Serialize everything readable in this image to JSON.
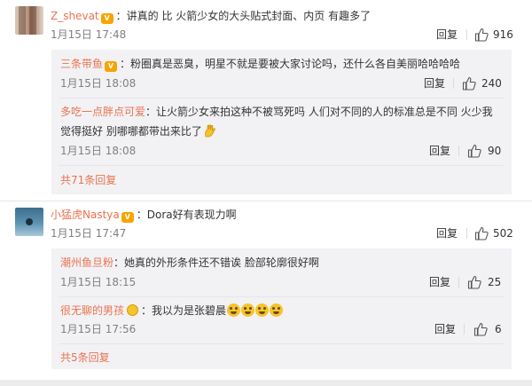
{
  "comments": [
    {
      "user": "Z_shevat",
      "vip_badge": "V",
      "text": "：讲真的 比 火箭少女的大头贴式封面、内页 有趣多了",
      "time": "1月15日 17:48",
      "reply_label": "回复",
      "likes": "916",
      "replies": [
        {
          "user": "三条带鱼",
          "vip_badge": "V",
          "text": "：粉圈真是恶臭，明星不就是要被大家讨论吗，还什么各自美丽哈哈哈哈",
          "time": "1月15日 18:08",
          "reply_label": "回复",
          "likes": "240"
        },
        {
          "user": "多吃一点胖点可爱",
          "text": "：让火箭少女来拍这种不被骂死吗 人们对不同的人的标准总是不同 火少我",
          "text2": "觉得挺好 别哪哪都带出来比了",
          "time": "1月15日 18:08",
          "reply_label": "回复",
          "likes": "90"
        }
      ],
      "more_label": "共71条回复"
    },
    {
      "user": "小猛虎Nastya",
      "vip_badge": "V",
      "text": "：Dora好有表现力啊",
      "time": "1月15日 17:47",
      "reply_label": "回复",
      "likes": "502",
      "replies": [
        {
          "user": "潮州鱼旦粉",
          "text": "：她真的外形条件还不错诶 脸部轮廓很好啊",
          "time": "1月15日 18:15",
          "reply_label": "回复",
          "likes": "25"
        },
        {
          "user": "很无聊的男孩",
          "text": "：我以为是张碧晨",
          "time": "1月15日 17:56",
          "reply_label": "回复",
          "likes": "6"
        }
      ],
      "more_label": "共5条回复"
    }
  ],
  "colors": {
    "username": "#eb7350",
    "sub_bg": "#f2f2f5",
    "meta": "#808080"
  },
  "icons": {
    "like": "thumbs-up-icon",
    "vip": "vip-crown-badge",
    "emoji": "laugh-cry-emoji",
    "ok_hand": "ok-hand-emoji"
  }
}
